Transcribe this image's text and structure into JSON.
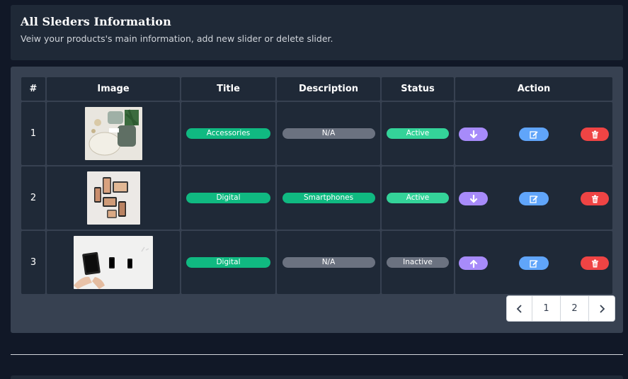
{
  "header": {
    "title": "All Sleders Information",
    "subtitle": "Veiw your products's main information, add new slider or delete slider."
  },
  "table": {
    "columns": [
      "#",
      "Image",
      "Title",
      "Description",
      "Status",
      "Action"
    ],
    "rows": [
      {
        "num": "1",
        "image": "accessories-photo",
        "title": "Accessories",
        "description": "N/A",
        "status": "Active",
        "move": "down"
      },
      {
        "num": "2",
        "image": "smartphones-photo",
        "title": "Digital",
        "description": "Smartphones",
        "status": "Active",
        "move": "down"
      },
      {
        "num": "3",
        "image": "tablet-photo",
        "title": "Digital",
        "description": "N/A",
        "status": "Inactive",
        "move": "up"
      }
    ]
  },
  "pagination": {
    "prev_icon": "chevron-left-icon",
    "pages": [
      "1",
      "2"
    ],
    "next_icon": "chevron-right-icon"
  },
  "colors": {
    "title_pill": "#10b981",
    "active_pill": "#34d399",
    "na_pill": "#6b7280",
    "move_btn": "#a78bfa",
    "edit_btn": "#60a5fa",
    "delete_btn": "#ef4444"
  }
}
